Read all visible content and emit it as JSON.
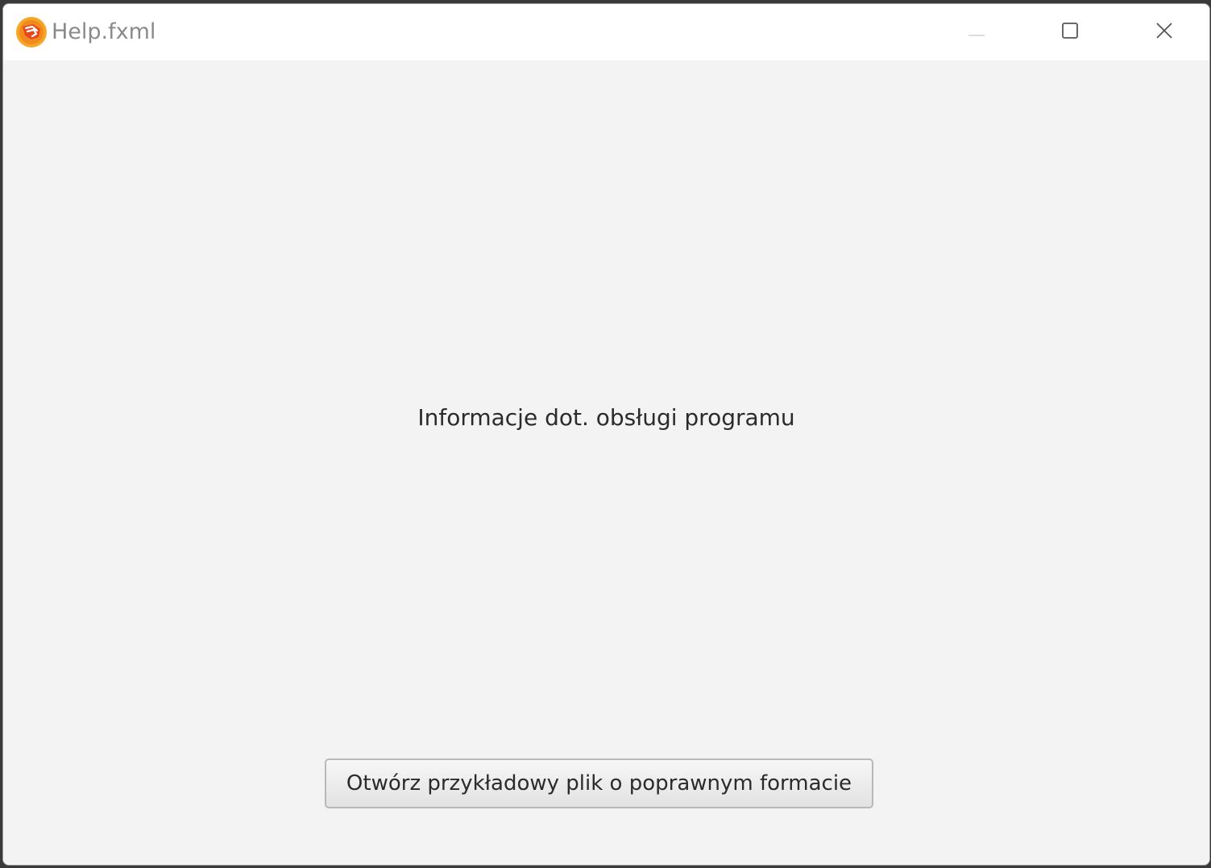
{
  "window": {
    "title": "Help.fxml",
    "app_icon": "hand-logo-icon"
  },
  "caption_buttons": {
    "minimize_icon": "minimize-icon",
    "maximize_icon": "maximize-icon",
    "close_icon": "close-icon"
  },
  "main": {
    "info_text": "Informacje dot. obsługi programu",
    "open_example_button_label": "Otwórz przykładowy plik o poprawnym formacie"
  },
  "colors": {
    "titlebar_bg": "#ffffff",
    "content_bg": "#f3f3f3",
    "logo_orange": "#f39a1e",
    "logo_red": "#e8471c"
  }
}
